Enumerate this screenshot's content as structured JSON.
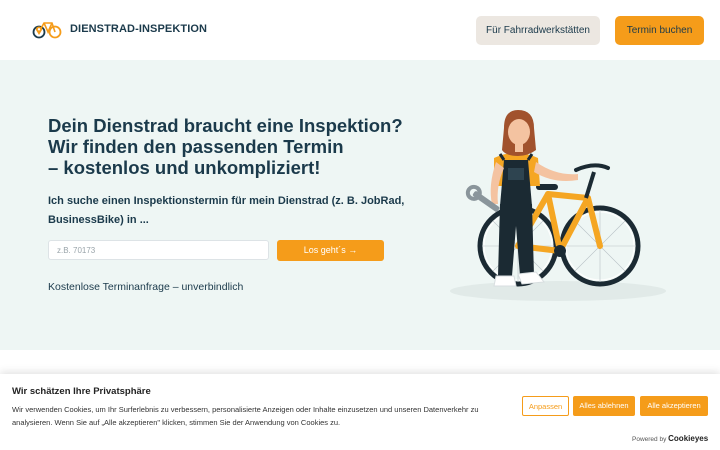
{
  "header": {
    "brand": "DIENSTRAD-INSPEKTION",
    "workshops_label": "Für Fahrradwerkstätten",
    "book_label": "Termin buchen"
  },
  "hero": {
    "title_lines": [
      "Dein Dienstrad braucht eine Inspektion?",
      "Wir finden den passenden Termin",
      "– kostenlos und unkompliziert!"
    ],
    "subtitle_lines": [
      "Ich suche einen Inspektionstermin für mein Dienstrad (z. B. JobRad,",
      "BusinessBike) in ..."
    ],
    "zip_placeholder": "z.B. 70173",
    "zip_value": "",
    "go_label": "Los geht´s →",
    "note": "Kostenlose Terminanfrage – unverbindlich"
  },
  "cookie": {
    "title": "Wir schätzen Ihre Privatsphäre",
    "text": "Wir verwenden Cookies, um Ihr Surferlebnis zu verbessern, personalisierte Anzeigen oder Inhalte einzusetzen und unseren Datenverkehr zu analysieren. Wenn Sie auf „Alle akzeptieren\" klicken, stimmen Sie der Anwendung von Cookies zu.",
    "adjust_label": "Anpassen",
    "reject_label": "Alles ablehnen",
    "accept_label": "Alle akzeptieren",
    "powered_label": "Powered by",
    "powered_brand": "Cookieyes"
  },
  "icons": {
    "logo": "bike-location-logo-icon",
    "illustration": "mechanic-with-bicycle-illustration"
  },
  "colors": {
    "accent": "#f59c1a",
    "text_dark": "#1b3a4b",
    "hero_bg": "#eef6f4",
    "secondary_button_bg": "#ece7e1"
  }
}
